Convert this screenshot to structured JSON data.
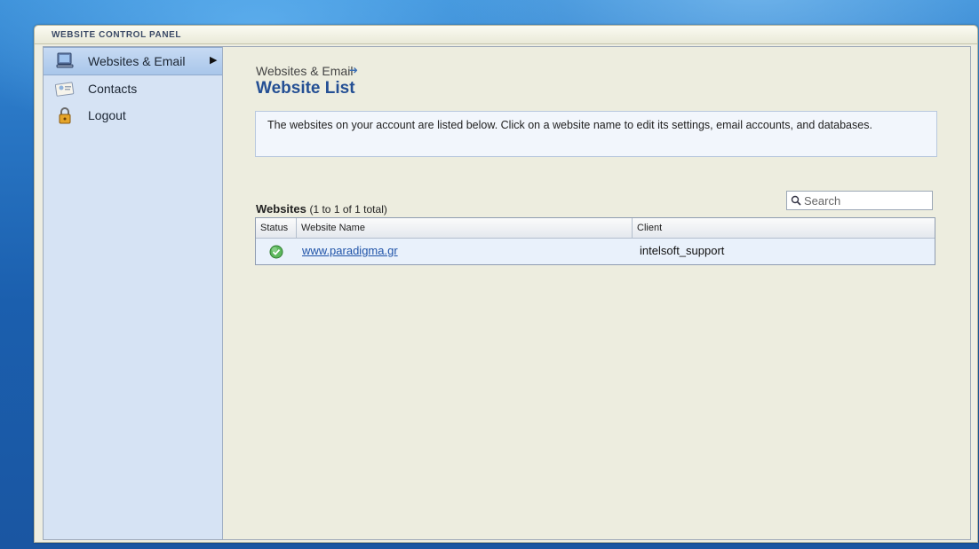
{
  "window": {
    "title": "WEBSITE CONTROL PANEL"
  },
  "sidebar": {
    "items": [
      {
        "label": "Websites & Email",
        "icon": "computer-icon",
        "active": true
      },
      {
        "label": "Contacts",
        "icon": "contact-card-icon",
        "active": false
      },
      {
        "label": "Logout",
        "icon": "lock-icon",
        "active": false
      }
    ]
  },
  "breadcrumb": {
    "parent": "Websites & Email"
  },
  "page": {
    "title": "Website List",
    "info": "The websites on your account are listed below. Click on a website name to edit its settings, email accounts, and databases."
  },
  "websites": {
    "title": "Websites",
    "count_text": "(1 to 1 of 1 total)",
    "search_placeholder": "Search",
    "columns": [
      "Status",
      "Website Name",
      "Client"
    ],
    "rows": [
      {
        "status": "active",
        "status_icon": "check-circle-icon",
        "name": "www.paradigma.gr",
        "client": "intelsoft_support"
      }
    ]
  },
  "colors": {
    "title_blue": "#244f94",
    "link_blue": "#1f53a8",
    "sidebar_bg": "#d6e3f4",
    "status_green": "#4cae4c"
  }
}
